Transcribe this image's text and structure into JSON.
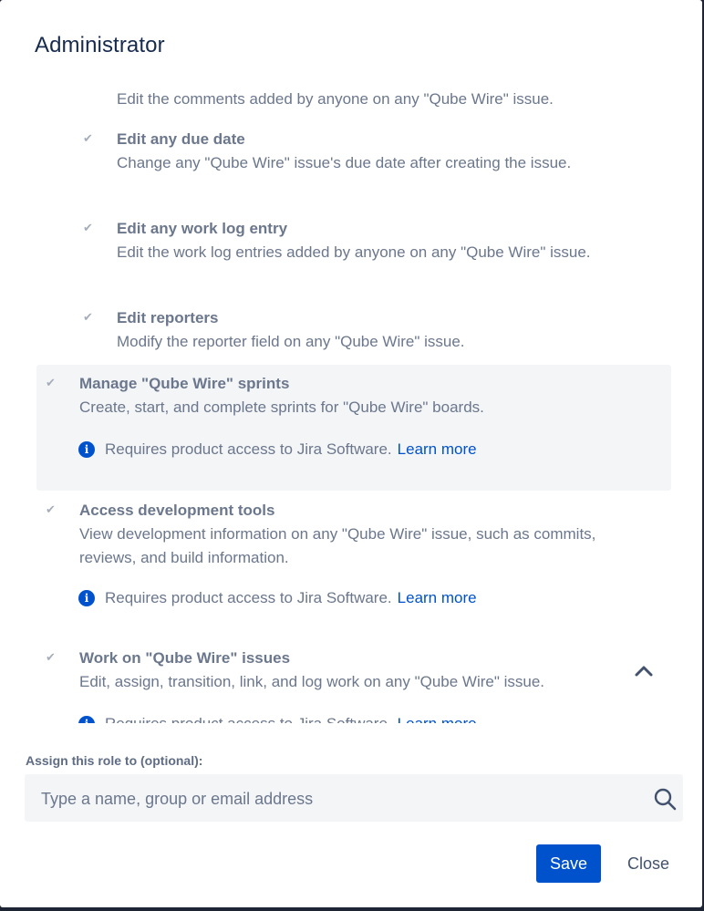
{
  "dialog": {
    "title": "Administrator"
  },
  "permissions": [
    {
      "name": "",
      "description": "Edit the comments added by anyone on any \"Qube Wire\" issue."
    },
    {
      "name": "Edit any due date",
      "description": "Change any \"Qube Wire\" issue's due date after creating the issue."
    },
    {
      "name": "Edit any work log entry",
      "description": "Edit the work log entries added by anyone on any \"Qube Wire\" issue."
    },
    {
      "name": "Edit reporters",
      "description": "Modify the reporter field on any \"Qube Wire\" issue."
    },
    {
      "name": "Manage \"Qube Wire\" sprints",
      "description": "Create, start, and complete sprints for \"Qube Wire\" boards.",
      "note": "Requires product access to Jira Software.",
      "link": "Learn more"
    },
    {
      "name": "Access development tools",
      "description": "View development information on any \"Qube Wire\" issue, such as commits, reviews, and build information.",
      "note": "Requires product access to Jira Software.",
      "link": "Learn more"
    },
    {
      "name": "Work on \"Qube Wire\" issues",
      "description": "Edit, assign, transition, link, and log work on any \"Qube Wire\" issue.",
      "note": "Requires product access to Jira Software.",
      "link": "Learn more"
    }
  ],
  "icons": {
    "check": "check-icon",
    "info": "info-icon",
    "collapse": "chevron-up-icon",
    "search": "search-icon"
  },
  "assign": {
    "label": "Assign this role to (optional):",
    "placeholder": "Type a name, group or email address"
  },
  "footer": {
    "save_label": "Save",
    "close_label": "Close"
  },
  "colors": {
    "primary": "#0052cc",
    "text_muted": "#6b778c",
    "heading": "#172b4d",
    "highlight_bg": "#f4f5f7"
  }
}
